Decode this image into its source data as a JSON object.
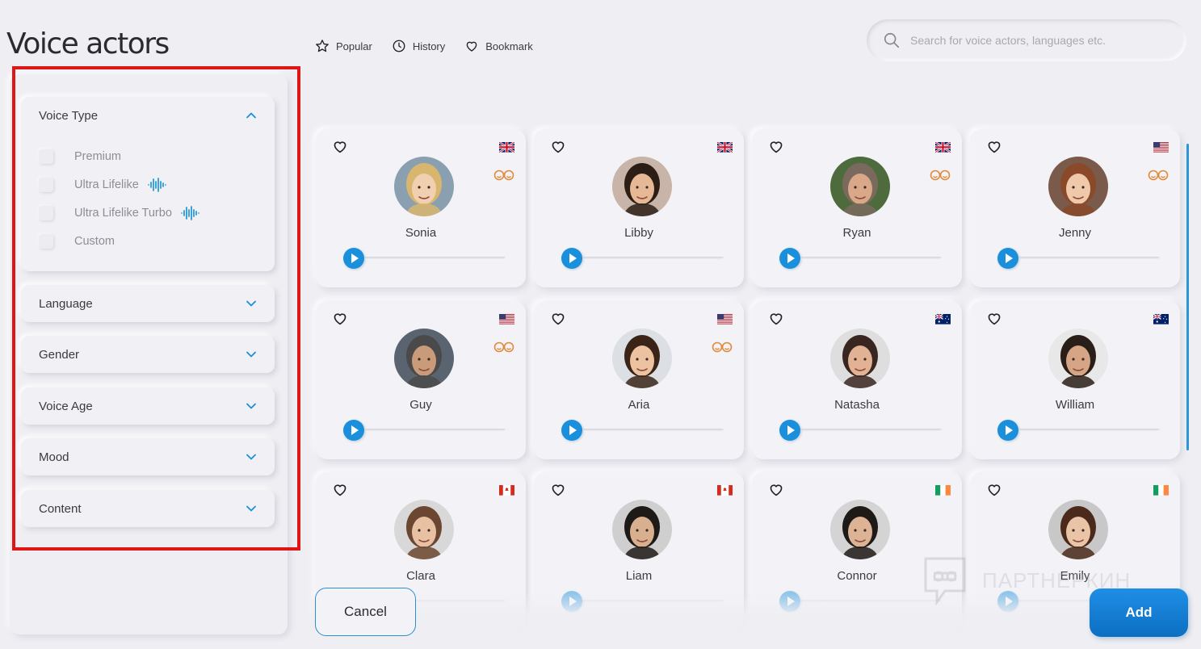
{
  "page_title": "Voice actors",
  "topnav": [
    {
      "label": "Popular",
      "icon": "star-icon"
    },
    {
      "label": "History",
      "icon": "clock-icon"
    },
    {
      "label": "Bookmark",
      "icon": "heart-icon"
    }
  ],
  "search": {
    "placeholder": "Search for voice actors, languages etc."
  },
  "filters": {
    "voice_type": {
      "label": "Voice Type",
      "expanded": true,
      "options": [
        {
          "label": "Premium",
          "checked": false
        },
        {
          "label": "Ultra Lifelike",
          "checked": false,
          "icon": "waveform-icon"
        },
        {
          "label": "Ultra Lifelike Turbo",
          "checked": false,
          "icon": "waveform-icon"
        },
        {
          "label": "Custom",
          "checked": false
        }
      ]
    },
    "language": {
      "label": "Language",
      "expanded": false
    },
    "gender": {
      "label": "Gender",
      "expanded": false
    },
    "voice_age": {
      "label": "Voice Age",
      "expanded": false
    },
    "mood": {
      "label": "Mood",
      "expanded": false
    },
    "content": {
      "label": "Content",
      "expanded": false
    }
  },
  "actors": [
    {
      "name": "Sonia",
      "flag": "uk",
      "emotions": true
    },
    {
      "name": "Libby",
      "flag": "uk",
      "emotions": false
    },
    {
      "name": "Ryan",
      "flag": "uk",
      "emotions": true
    },
    {
      "name": "Jenny",
      "flag": "us",
      "emotions": true
    },
    {
      "name": "Guy",
      "flag": "us",
      "emotions": true
    },
    {
      "name": "Aria",
      "flag": "us",
      "emotions": true
    },
    {
      "name": "Natasha",
      "flag": "au",
      "emotions": false
    },
    {
      "name": "William",
      "flag": "au",
      "emotions": false
    },
    {
      "name": "Clara",
      "flag": "ca",
      "emotions": false
    },
    {
      "name": "Liam",
      "flag": "ca",
      "emotions": false
    },
    {
      "name": "Connor",
      "flag": "ie",
      "emotions": false
    },
    {
      "name": "Emily",
      "flag": "ie",
      "emotions": false
    }
  ],
  "buttons": {
    "cancel": "Cancel",
    "add": "Add"
  },
  "watermark": "ПАРТНЕРКИН",
  "colors": {
    "accent": "#1a8fdc",
    "highlight": "#e01515",
    "emotion": "#e08a3c"
  }
}
